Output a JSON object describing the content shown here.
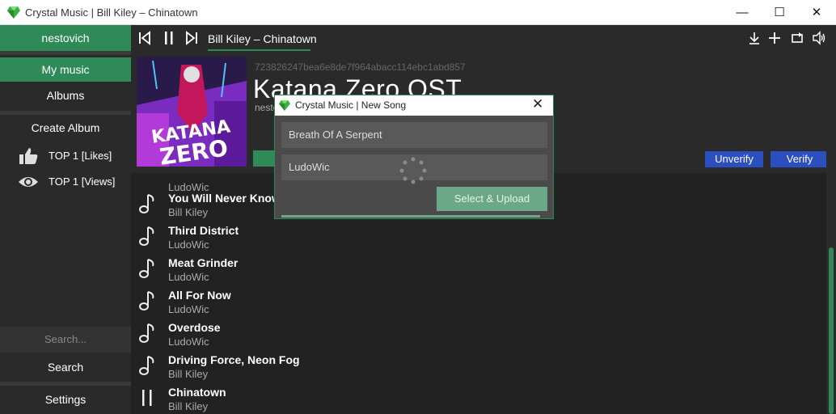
{
  "window": {
    "title": "Crystal Music | Bill Kiley – Chinatown",
    "minimize": "—",
    "maximize": "☐",
    "close": "✕"
  },
  "sidebar": {
    "user": "nestovich",
    "items": [
      {
        "label": "My music",
        "active": true
      },
      {
        "label": "Albums"
      },
      {
        "label": "Create Album"
      }
    ],
    "tops": [
      {
        "label": "TOP 1 [Likes]",
        "icon": "thumbs-up-icon"
      },
      {
        "label": "TOP 1 [Views]",
        "icon": "eye-icon"
      }
    ],
    "search_placeholder": "Search...",
    "search_button": "Search",
    "settings": "Settings"
  },
  "player": {
    "now_playing": "Bill Kiley – Chinatown",
    "icons": [
      "previous-icon",
      "pause-icon",
      "next-icon",
      "download-icon",
      "add-icon",
      "repeat-icon",
      "volume-icon"
    ]
  },
  "album": {
    "hash": "723826247bea6e8de7f964abacc114ebc1abd857",
    "title": "Katana Zero OST",
    "owner": "nestovich",
    "unverify": "Unverify",
    "verify": "Verify",
    "cover_text": "KATANA ZERO"
  },
  "songs": [
    {
      "title": "",
      "artist": "LudoWic"
    },
    {
      "title": "You Will Never Know",
      "artist": "Bill Kiley"
    },
    {
      "title": "Third District",
      "artist": "LudoWic"
    },
    {
      "title": "Meat Grinder",
      "artist": "LudoWic"
    },
    {
      "title": "All For Now",
      "artist": "LudoWic"
    },
    {
      "title": "Overdose",
      "artist": "LudoWic"
    },
    {
      "title": "Driving Force, Neon Fog",
      "artist": "Bill Kiley"
    },
    {
      "title": "Chinatown",
      "artist": "Bill Kiley",
      "playing": true
    }
  ],
  "dialog": {
    "title": "Crystal Music | New Song",
    "close": "✕",
    "song_name": "Breath Of A Serpent",
    "artist": "LudoWic",
    "upload_button": "Select & Upload"
  },
  "colors": {
    "accent": "#2e8b57",
    "verify_blue": "#2b4ec0",
    "background": "#222222"
  }
}
